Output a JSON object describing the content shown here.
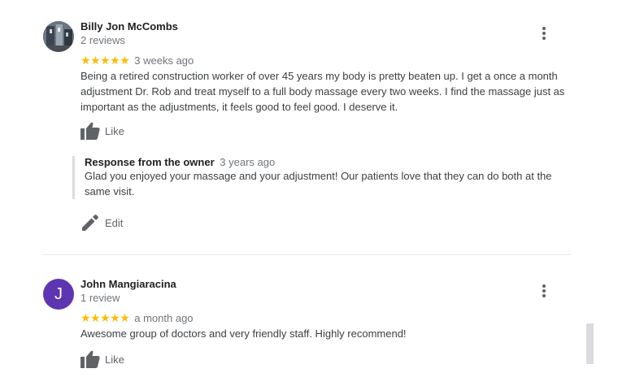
{
  "reviews": [
    {
      "name": "Billy Jon McCombs",
      "count": "2 reviews",
      "stars": "★★★★★",
      "time": "3 weeks ago",
      "text": "Being a retired construction worker of over 45 years my body is pretty beaten up. I get a once a month adjustment Dr. Rob and treat myself to a full body massage every two weeks. I find the massage just as important as the adjustments, it feels good to feel good. I deserve it.",
      "like_label": "Like",
      "owner_response": {
        "title": "Response from the owner",
        "time": "3 years ago",
        "text": "Glad you enjoyed your massage and your adjustment! Our patients love that they can do both at the same visit."
      },
      "edit_label": "Edit"
    },
    {
      "avatar_letter": "J",
      "name": "John Mangiaracina",
      "count": "1 review",
      "stars": "★★★★★",
      "time": "a month ago",
      "text": "Awesome group of doctors and very friendly staff. Highly recommend!",
      "like_label": "Like"
    }
  ],
  "colors": {
    "star": "#fbbc04",
    "avatar_j": "#5e35b1"
  },
  "icons": [
    "more-vert-icon",
    "thumb-up-icon",
    "pencil-icon"
  ]
}
